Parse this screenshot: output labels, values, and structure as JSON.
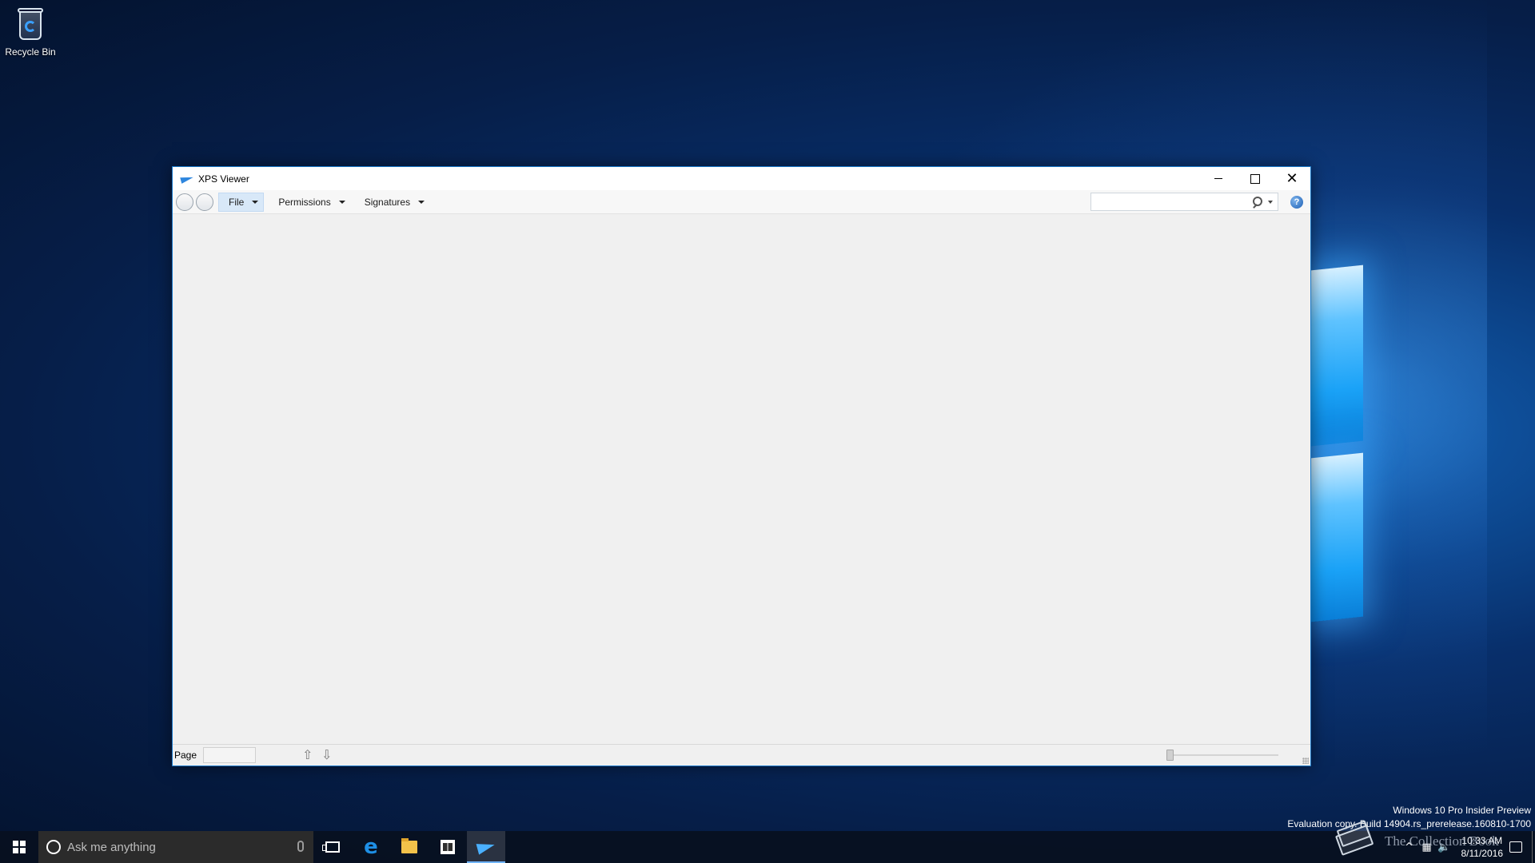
{
  "desktop": {
    "recycle_bin_label": "Recycle Bin"
  },
  "window": {
    "title": "XPS Viewer",
    "menus": [
      {
        "label": "File"
      },
      {
        "label": "Permissions"
      },
      {
        "label": "Signatures"
      }
    ],
    "search": {
      "value": "",
      "placeholder": ""
    },
    "help_label": "?",
    "status": {
      "page_label": "Page",
      "page_value": "",
      "zoom_level": 0
    }
  },
  "watermark": {
    "line1": "Windows 10 Pro Insider Preview",
    "line2": "Evaluation copy. Build 14904.rs_prerelease.160810-1700"
  },
  "taskbar": {
    "search_placeholder": "Ask me anything",
    "clock_time": "10:33 AM",
    "clock_date": "8/11/2016",
    "brand_text": "The Collection Book"
  },
  "colors": {
    "accent": "#1979ca",
    "taskbar_active": "#6fb4ff"
  },
  "icons": {
    "app": "xps-viewer-icon",
    "help": "help-icon",
    "search": "search-icon"
  }
}
